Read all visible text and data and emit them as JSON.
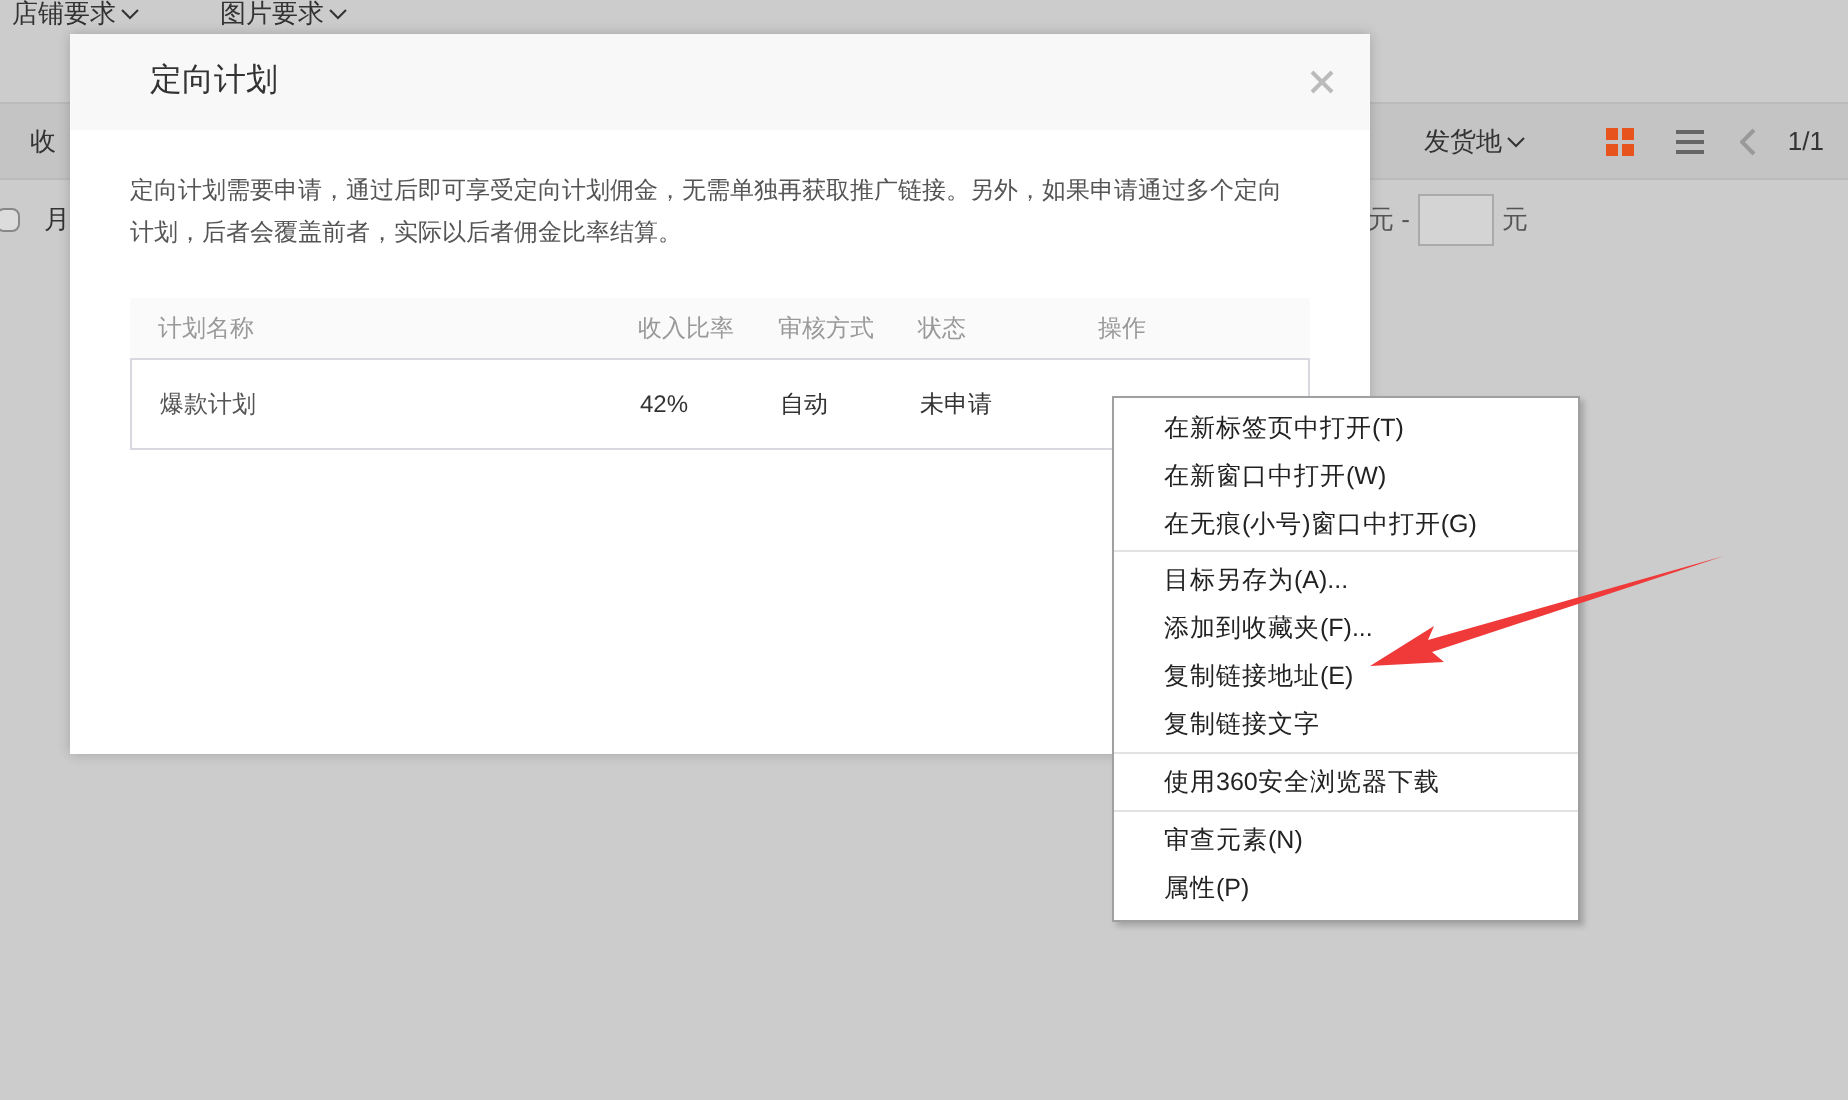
{
  "page": {
    "filters": [
      "店铺要求",
      "图片要求"
    ],
    "toolbar": {
      "sort_label": "收",
      "ship_from": "发货地",
      "views": [
        {
          "kind": "grid",
          "selected": true
        },
        {
          "kind": "list",
          "selected": false
        }
      ],
      "pagination": "1/1"
    },
    "filter_row": {
      "checkbox_label": "月",
      "checked": false,
      "price_from_unit": "元 -",
      "price_to_unit": "元"
    }
  },
  "dialog": {
    "title": "定向计划",
    "description": "定向计划需要申请，通过后即可享受定向计划佣金，无需单独再获取推广链接。另外，如果申请通过多个定向计划，后者会覆盖前者，实际以后者佣金比率结算。",
    "table": {
      "columns": [
        "计划名称",
        "收入比率",
        "审核方式",
        "状态",
        "操作"
      ],
      "rows": [
        {
          "name": "爆款计划",
          "rate": "42%",
          "review": "自动",
          "status": "未申请"
        }
      ]
    }
  },
  "context_menu": {
    "sections": [
      [
        "在新标签页中打开(T)",
        "在新窗口中打开(W)",
        "在无痕(小号)窗口中打开(G)"
      ],
      [
        "目标另存为(A)...",
        "添加到收藏夹(F)...",
        "复制链接地址(E)",
        "复制链接文字"
      ],
      [
        "使用360安全浏览器下载"
      ],
      [
        "审查元素(N)",
        "属性(P)"
      ]
    ]
  }
}
